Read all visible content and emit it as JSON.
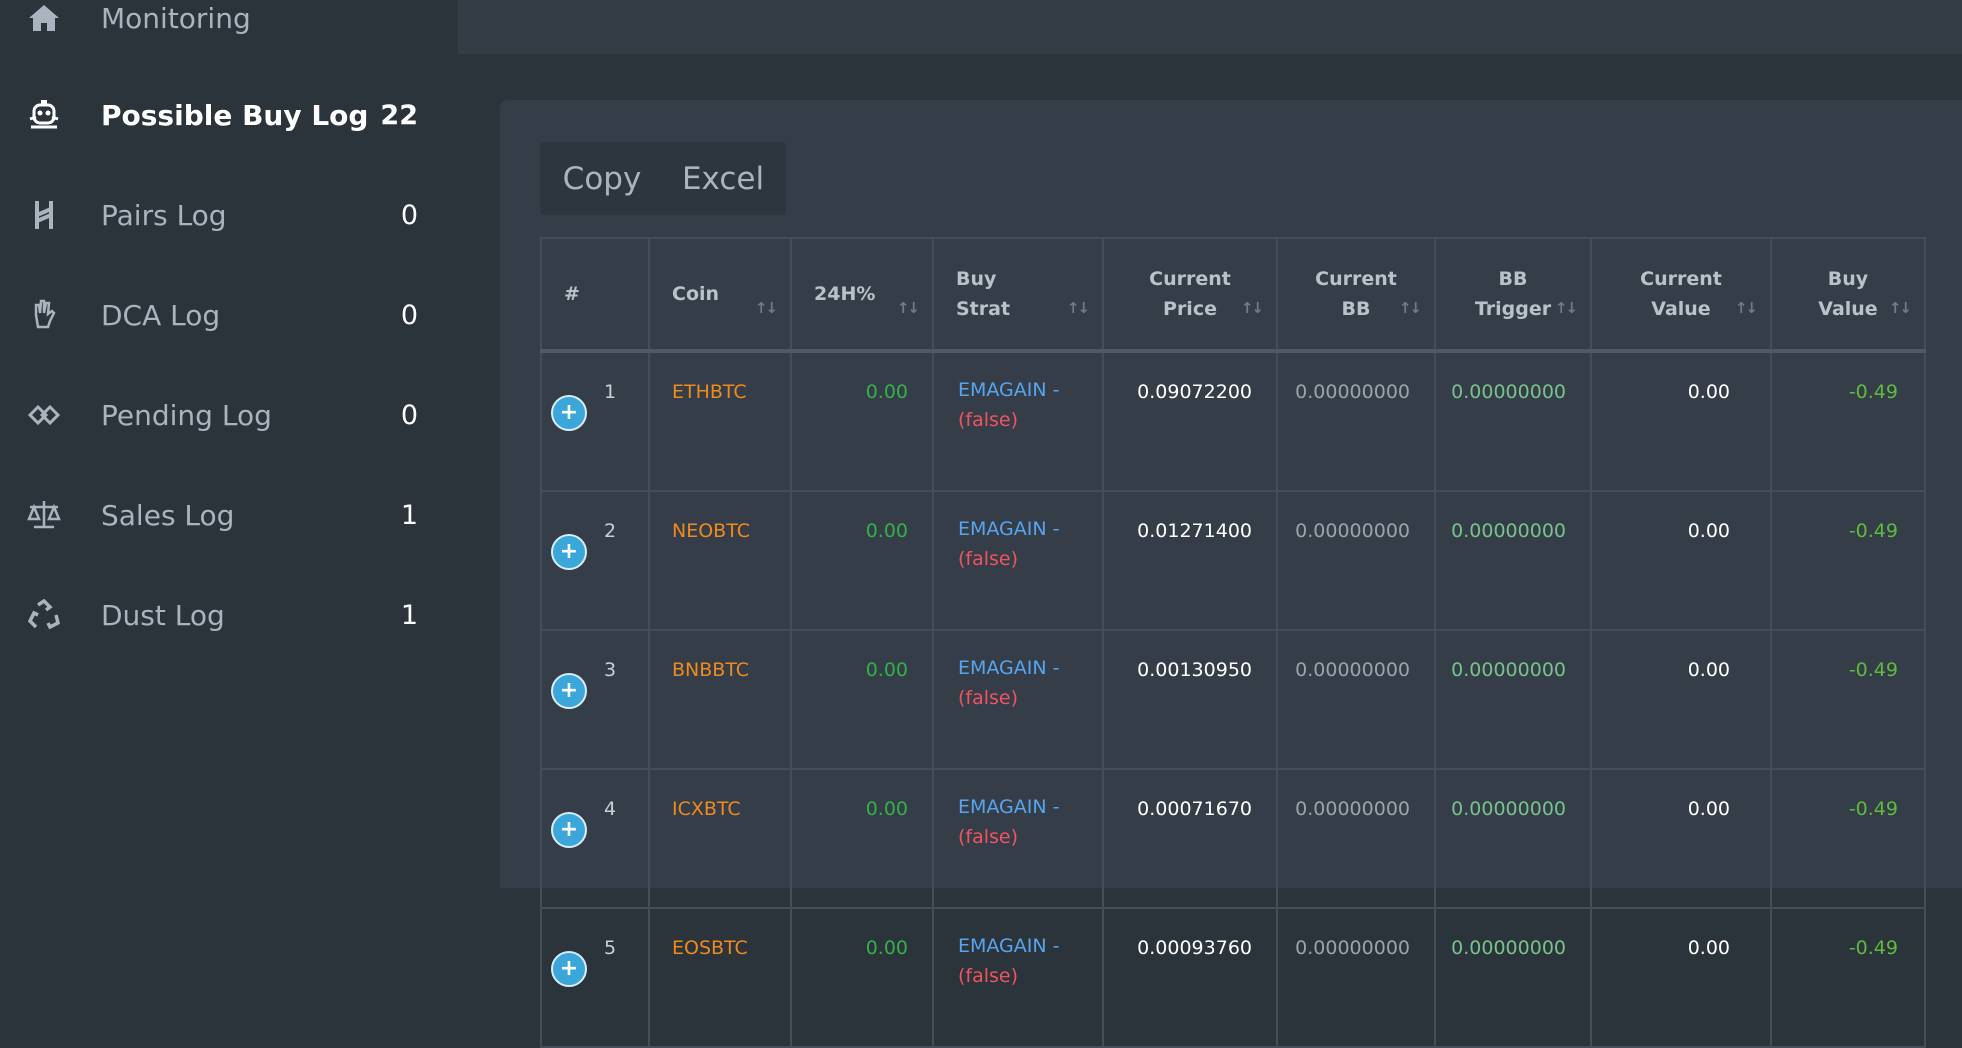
{
  "sidebar": {
    "items": [
      {
        "label": "Monitoring",
        "count": "",
        "icon": "home-icon"
      },
      {
        "label": "Possible Buy Log",
        "count": "22",
        "icon": "robot-icon"
      },
      {
        "label": "Pairs Log",
        "count": "0",
        "icon": "pairs-icon"
      },
      {
        "label": "DCA Log",
        "count": "0",
        "icon": "hand-icon"
      },
      {
        "label": "Pending Log",
        "count": "0",
        "icon": "pending-icon"
      },
      {
        "label": "Sales Log",
        "count": "1",
        "icon": "scale-icon"
      },
      {
        "label": "Dust Log",
        "count": "1",
        "icon": "recycle-icon"
      }
    ]
  },
  "toolbar": {
    "copy_label": "Copy",
    "excel_label": "Excel"
  },
  "table": {
    "headers": {
      "num": "#",
      "coin": "Coin",
      "pct": "24H%",
      "strat_1": "Buy",
      "strat_2": "Strat",
      "price_1": "Current",
      "price_2": "Price",
      "bb_1": "Current",
      "bb_2": "BB",
      "trig_1": "BB",
      "trig_2": "Trigger",
      "cv_1": "Current",
      "cv_2": "Value",
      "bv_1": "Buy",
      "bv_2": "Value"
    },
    "sort_glyph": "↑↓",
    "expand_glyph": "+",
    "rows": [
      {
        "num": "1",
        "coin": "ETHBTC",
        "pct": "0.00",
        "strat": "EMAGAIN -",
        "strat_flag": "(false)",
        "price": "0.09072200",
        "bb": "0.00000000",
        "trig": "0.00000000",
        "cv": "0.00",
        "bv": "-0.49"
      },
      {
        "num": "2",
        "coin": "NEOBTC",
        "pct": "0.00",
        "strat": "EMAGAIN -",
        "strat_flag": "(false)",
        "price": "0.01271400",
        "bb": "0.00000000",
        "trig": "0.00000000",
        "cv": "0.00",
        "bv": "-0.49"
      },
      {
        "num": "3",
        "coin": "BNBBTC",
        "pct": "0.00",
        "strat": "EMAGAIN -",
        "strat_flag": "(false)",
        "price": "0.00130950",
        "bb": "0.00000000",
        "trig": "0.00000000",
        "cv": "0.00",
        "bv": "-0.49"
      },
      {
        "num": "4",
        "coin": "ICXBTC",
        "pct": "0.00",
        "strat": "EMAGAIN -",
        "strat_flag": "(false)",
        "price": "0.00071670",
        "bb": "0.00000000",
        "trig": "0.00000000",
        "cv": "0.00",
        "bv": "-0.49"
      },
      {
        "num": "5",
        "coin": "EOSBTC",
        "pct": "0.00",
        "strat": "EMAGAIN -",
        "strat_flag": "(false)",
        "price": "0.00093760",
        "bb": "0.00000000",
        "trig": "0.00000000",
        "cv": "0.00",
        "bv": "-0.49"
      }
    ]
  },
  "colors": {
    "background": "#2b333b",
    "card": "#353e48",
    "coin": "#ef8a1e",
    "positive": "#34b04a",
    "strategy": "#58a5ef",
    "false_flag": "#f05460",
    "expand_button": "#3aa6da"
  }
}
